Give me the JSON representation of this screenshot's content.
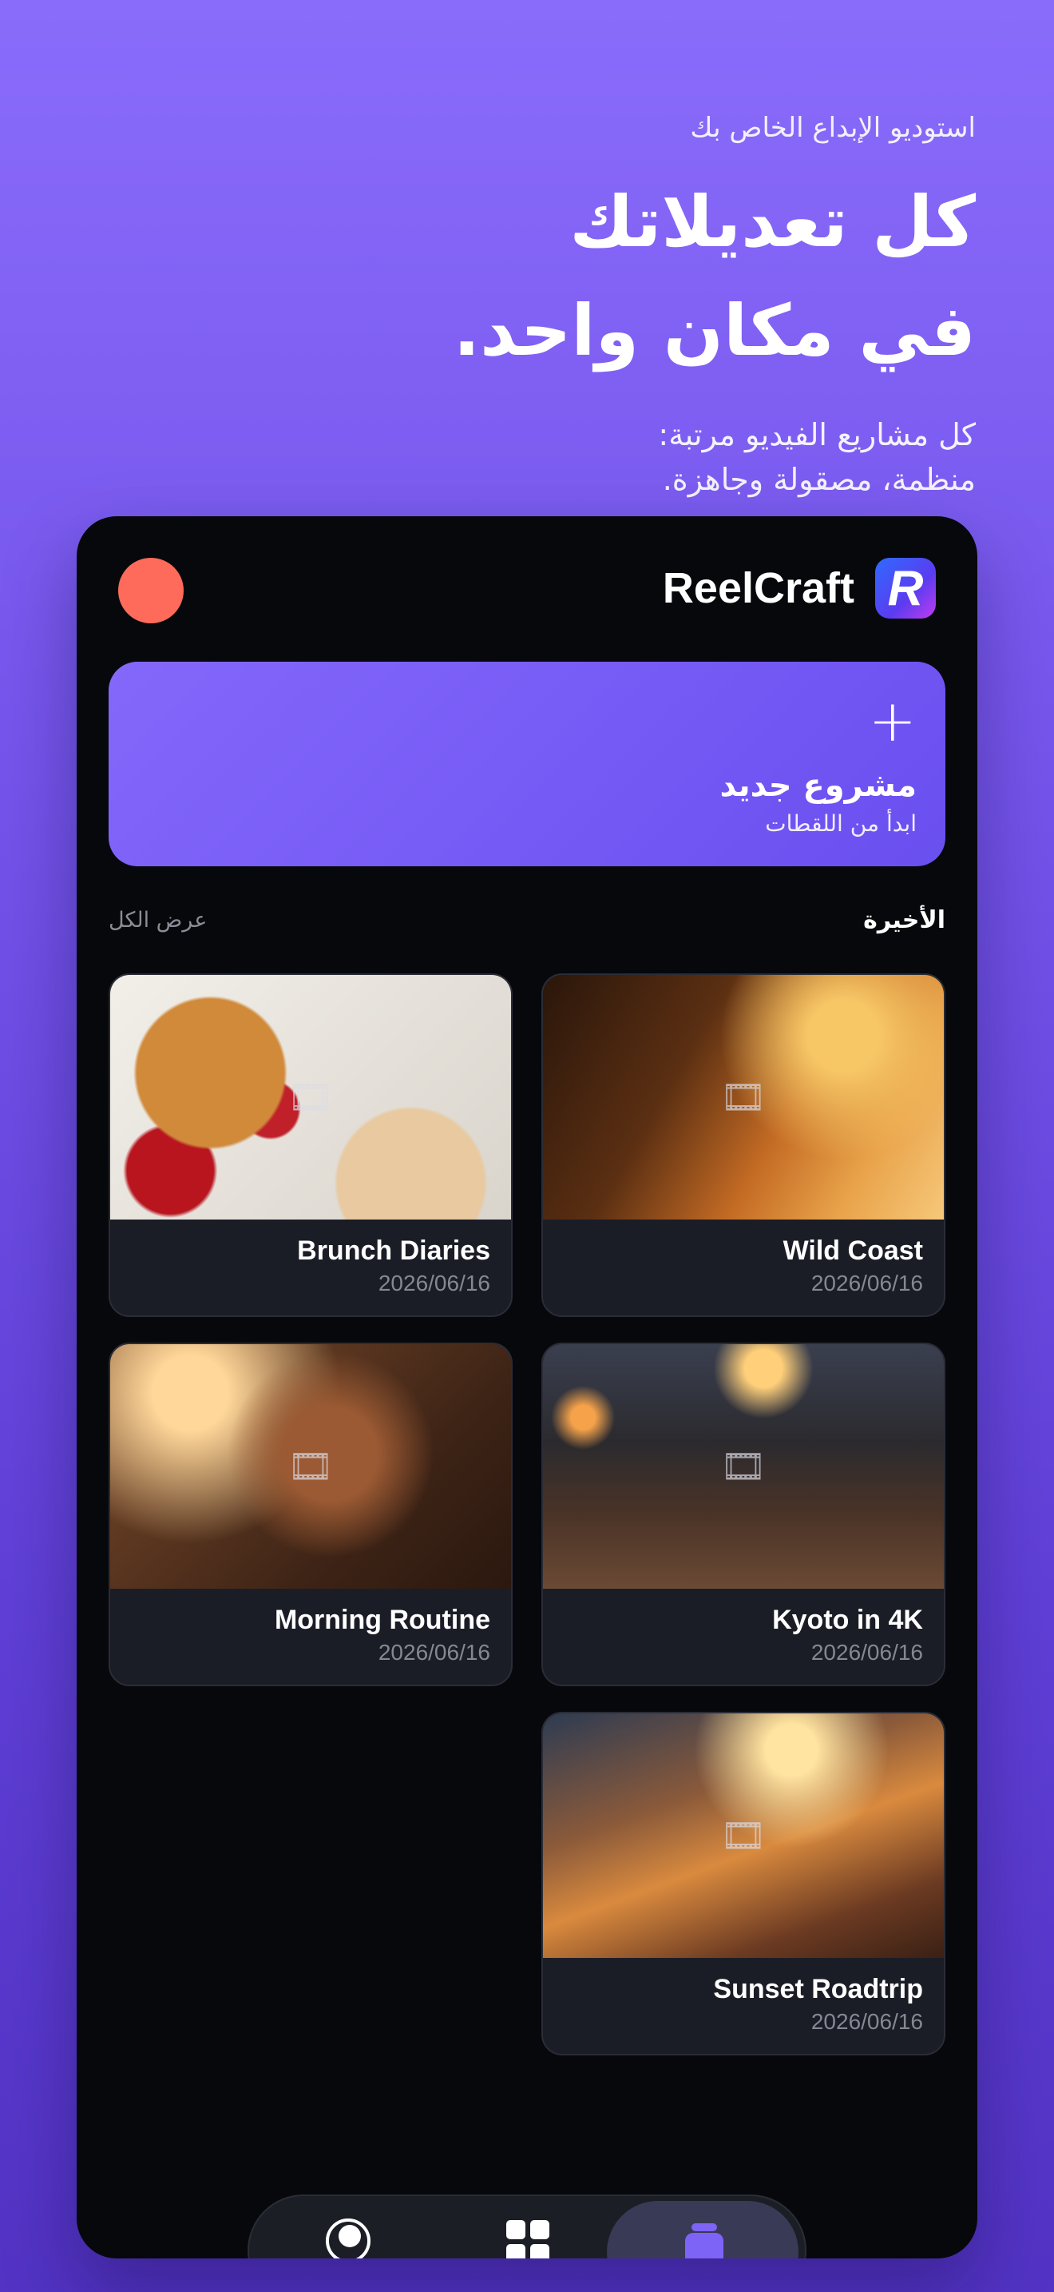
{
  "hero": {
    "eyebrow": "استوديو الإبداع الخاص بك",
    "headline_line1": "كل تعديلاتك",
    "headline_line2": "في مكان واحد.",
    "sub_line1": "كل مشاريع الفيديو مرتبة:",
    "sub_line2": "منظمة، مصقولة وجاهزة."
  },
  "app": {
    "brand_name": "ReelCraft",
    "brand_logo_letter": "R",
    "new_project": {
      "plus": "+",
      "label": "مشروع جديد",
      "hint": "ابدأ من اللقطات"
    },
    "recent": {
      "title": "الأخيرة",
      "see_all": "عرض الكل"
    },
    "projects": [
      {
        "name": "Wild Coast",
        "date": "2026/06/16"
      },
      {
        "name": "Brunch Diaries",
        "date": "2026/06/16"
      },
      {
        "name": "Kyoto in 4K",
        "date": "2026/06/16"
      },
      {
        "name": "Morning Routine",
        "date": "2026/06/16"
      },
      {
        "name": "Sunset Roadtrip",
        "date": "2026/06/16"
      }
    ],
    "film_icon": "🎞",
    "tabs": [
      "profile-icon",
      "grid-icon",
      "projects-stack-icon"
    ],
    "accent_color": "#7e63f7",
    "avatar_color": "#ff6b5a"
  }
}
